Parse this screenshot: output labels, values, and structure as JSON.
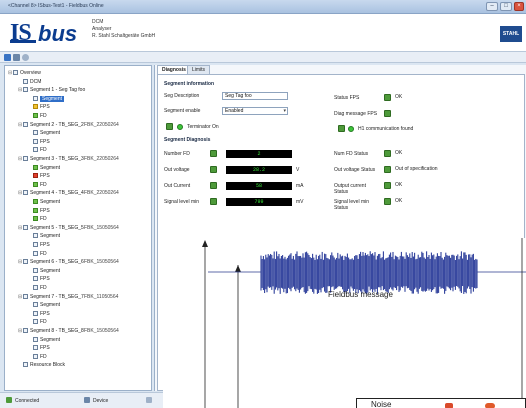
{
  "window": {
    "title": "<Channel 8> ISbus-Test1 - Fieldbus Online",
    "controls": [
      "–",
      "□",
      "×"
    ]
  },
  "header": {
    "device_line1": "DCM",
    "device_line2": "Analyser",
    "device_line3": "R. Stahl Schaltgeräte GmbH",
    "brand": "STAHL"
  },
  "tree": {
    "items": [
      {
        "label": "Overview",
        "fbk": "",
        "icon": "doc",
        "exp": "⊟",
        "depth": 0
      },
      {
        "label": "DCM",
        "fbk": "",
        "icon": "doc",
        "exp": "",
        "depth": 1
      },
      {
        "label": "Segment 1 - Seg Tag foo",
        "fbk": "",
        "icon": "doc",
        "exp": "⊟",
        "depth": 1
      },
      {
        "label": "Segment",
        "fbk": "",
        "icon": "doc",
        "exp": "",
        "depth": 2,
        "selected": true
      },
      {
        "label": "FPS",
        "fbk": "",
        "icon": "warn",
        "exp": "",
        "depth": 2
      },
      {
        "label": "FD",
        "fbk": "",
        "icon": "ok",
        "exp": "",
        "depth": 2
      },
      {
        "label": "Segment 2 - TB_SEG_2",
        "fbk": "FBK_22050264",
        "icon": "doc",
        "exp": "⊟",
        "depth": 1
      },
      {
        "label": "Segment",
        "fbk": "",
        "icon": "doc",
        "exp": "",
        "depth": 2
      },
      {
        "label": "FPS",
        "fbk": "",
        "icon": "doc",
        "exp": "",
        "depth": 2
      },
      {
        "label": "FD",
        "fbk": "",
        "icon": "doc",
        "exp": "",
        "depth": 2
      },
      {
        "label": "Segment 3 - TB_SEG_3",
        "fbk": "FBK_22050264",
        "icon": "doc",
        "exp": "⊟",
        "depth": 1
      },
      {
        "label": "Segment",
        "fbk": "",
        "icon": "ok",
        "exp": "",
        "depth": 2
      },
      {
        "label": "FPS",
        "fbk": "",
        "icon": "err",
        "exp": "",
        "depth": 2
      },
      {
        "label": "FD",
        "fbk": "",
        "icon": "ok",
        "exp": "",
        "depth": 2
      },
      {
        "label": "Segment 4 - TB_SEG_4",
        "fbk": "FBK_22050264",
        "icon": "doc",
        "exp": "⊟",
        "depth": 1
      },
      {
        "label": "Segment",
        "fbk": "",
        "icon": "ok",
        "exp": "",
        "depth": 2
      },
      {
        "label": "FPS",
        "fbk": "",
        "icon": "ok",
        "exp": "",
        "depth": 2
      },
      {
        "label": "FD",
        "fbk": "",
        "icon": "ok",
        "exp": "",
        "depth": 2
      },
      {
        "label": "Segment 5 - TB_SEG_5",
        "fbk": "FBK_15050564",
        "icon": "doc",
        "exp": "⊟",
        "depth": 1
      },
      {
        "label": "Segment",
        "fbk": "",
        "icon": "doc",
        "exp": "",
        "depth": 2
      },
      {
        "label": "FPS",
        "fbk": "",
        "icon": "doc",
        "exp": "",
        "depth": 2
      },
      {
        "label": "FD",
        "fbk": "",
        "icon": "doc",
        "exp": "",
        "depth": 2
      },
      {
        "label": "Segment 6 - TB_SEG_6",
        "fbk": "FBK_15050564",
        "icon": "doc",
        "exp": "⊟",
        "depth": 1
      },
      {
        "label": "Segment",
        "fbk": "",
        "icon": "doc",
        "exp": "",
        "depth": 2
      },
      {
        "label": "FPS",
        "fbk": "",
        "icon": "doc",
        "exp": "",
        "depth": 2
      },
      {
        "label": "FD",
        "fbk": "",
        "icon": "doc",
        "exp": "",
        "depth": 2
      },
      {
        "label": "Segment 7 - TB_SEG_7",
        "fbk": "FBK_11050564",
        "icon": "doc",
        "exp": "⊟",
        "depth": 1
      },
      {
        "label": "Segment",
        "fbk": "",
        "icon": "doc",
        "exp": "",
        "depth": 2
      },
      {
        "label": "FPS",
        "fbk": "",
        "icon": "doc",
        "exp": "",
        "depth": 2
      },
      {
        "label": "FD",
        "fbk": "",
        "icon": "doc",
        "exp": "",
        "depth": 2
      },
      {
        "label": "Segment 8 - TB_SEG_8",
        "fbk": "FBK_15050564",
        "icon": "doc",
        "exp": "⊟",
        "depth": 1
      },
      {
        "label": "Segment",
        "fbk": "",
        "icon": "doc",
        "exp": "",
        "depth": 2
      },
      {
        "label": "FPS",
        "fbk": "",
        "icon": "doc",
        "exp": "",
        "depth": 2
      },
      {
        "label": "FD",
        "fbk": "",
        "icon": "doc",
        "exp": "",
        "depth": 2
      },
      {
        "label": "Resource Block",
        "fbk": "",
        "icon": "doc",
        "exp": "",
        "depth": 1
      }
    ]
  },
  "status": {
    "connected": "Connected",
    "device": "Device"
  },
  "tabs": [
    {
      "label": "Diagnosis",
      "active": true
    },
    {
      "label": "Limits",
      "active": false
    }
  ],
  "segment_info": {
    "title": "Segment information",
    "tag_label": "Seg Description",
    "tag_value": "Seg Tag foo",
    "enable_label": "Segment enable",
    "enable_value": "Enabled",
    "terminator_label": "Terminator On",
    "status_fps_label": "Status FPS",
    "status_fps_value": "OK",
    "diag_msg_label": "Diag message FPS",
    "comm_label": "H1 communication found"
  },
  "segment_diag": {
    "title": "Segment Diagnosis",
    "rows": [
      {
        "label": "Number FD",
        "value": "2",
        "unit": ""
      },
      {
        "label": "Out voltage",
        "value": "28.2",
        "unit": "V"
      },
      {
        "label": "Out Current",
        "value": "58",
        "unit": "mA"
      },
      {
        "label": "Signal level min",
        "value": "799",
        "unit": "mV"
      }
    ],
    "right_rows": [
      {
        "label": "Num FD Status",
        "value": "OK"
      },
      {
        "label": "Out voltage Status",
        "value": "Out of specification"
      },
      {
        "label": "Output current Status",
        "value": "OK"
      },
      {
        "label": "Signal level min Status",
        "value": "OK"
      }
    ]
  },
  "scope": {
    "caption": "Fieldbus message",
    "noise_label": "Noise"
  }
}
